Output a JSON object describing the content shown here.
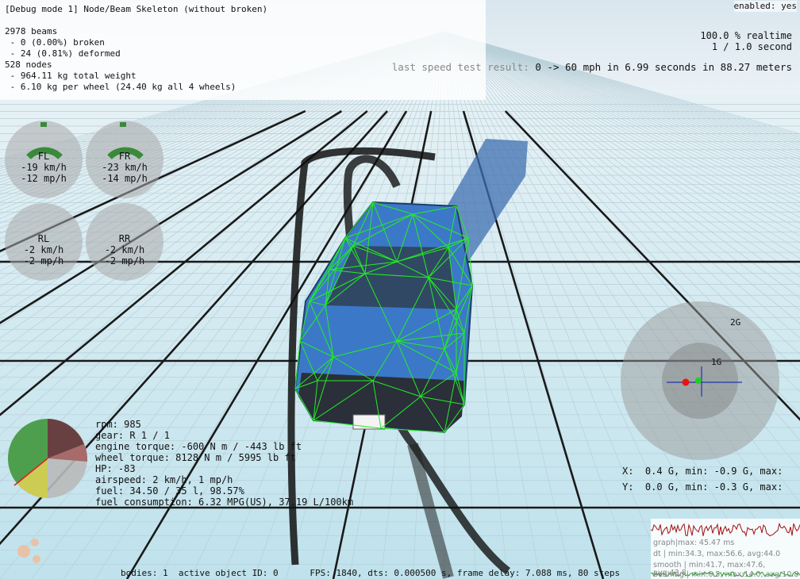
{
  "debug": {
    "title": "[Debug mode 1] Node/Beam Skeleton (without broken)",
    "lines": [
      "2978 beams",
      " - 0 (0.00%) broken",
      " - 24 (0.81%) deformed",
      "528 nodes",
      " - 964.11 kg total weight",
      " - 6.10 kg per wheel (24.40 kg all 4 wheels)"
    ]
  },
  "enabled": "enabled: yes",
  "realtime": {
    "percent": "100.0 % realtime",
    "ratio": "1 / 1.0 second"
  },
  "speed_test": {
    "label": "last speed test result:",
    "value": " 0 -> 60 mph in 6.99 seconds in 88.27 meters"
  },
  "wheels": [
    {
      "name": "FL",
      "kmh": "-19 km/h",
      "mph": "-12 mp/h"
    },
    {
      "name": "FR",
      "kmh": "-23 km/h",
      "mph": "-14 mp/h"
    },
    {
      "name": "RL",
      "kmh": "-2 km/h",
      "mph": "-2 mp/h"
    },
    {
      "name": "RR",
      "kmh": "-2 km/h",
      "mph": "-2 mp/h"
    }
  ],
  "engine": {
    "rpm": "rpm: 985",
    "gear": "gear: R 1 / 1",
    "engine_torque": "engine torque: -600 N m / -443 lb ft",
    "wheel_torque": "wheel torque: 8128 N m / 5995 lb ft",
    "hp": "HP: -83",
    "airspeed": "airspeed: 2 km/h, 1 mp/h",
    "fuel": "fuel: 34.50 / 35 l, 98.57%",
    "fuel_consumption": "fuel consumption: 6.32 MPG(US), 37.19 L/100km"
  },
  "gmeter": {
    "label_2g": "2G",
    "label_1g": "1G",
    "x": "X:  0.4 G, min: -0.9 G, max:",
    "y": "Y:  0.0 G, min: -0.3 G, max:"
  },
  "status": "bodies: 1  active object ID: 0      FPS: 1840, dts: 0.000500 s, frame delay: 7.088 ms, 80 steps",
  "graph": {
    "l1": "graph|max: 45.47 ms",
    "l2": "dt    | min:34.3, max:56.6, avg:44.0",
    "l3": "smooth | min:41.7, max:47.6, avg:43.8",
    "l4": "beamng | min:6.5, max:14.0, avg:10.8"
  },
  "colors": {
    "sky": "#e8f0f6",
    "ground": "#c9e6ee",
    "grid": "#1a1a1a",
    "car_blue": "#3c78c8",
    "wireframe": "#22ee22"
  }
}
